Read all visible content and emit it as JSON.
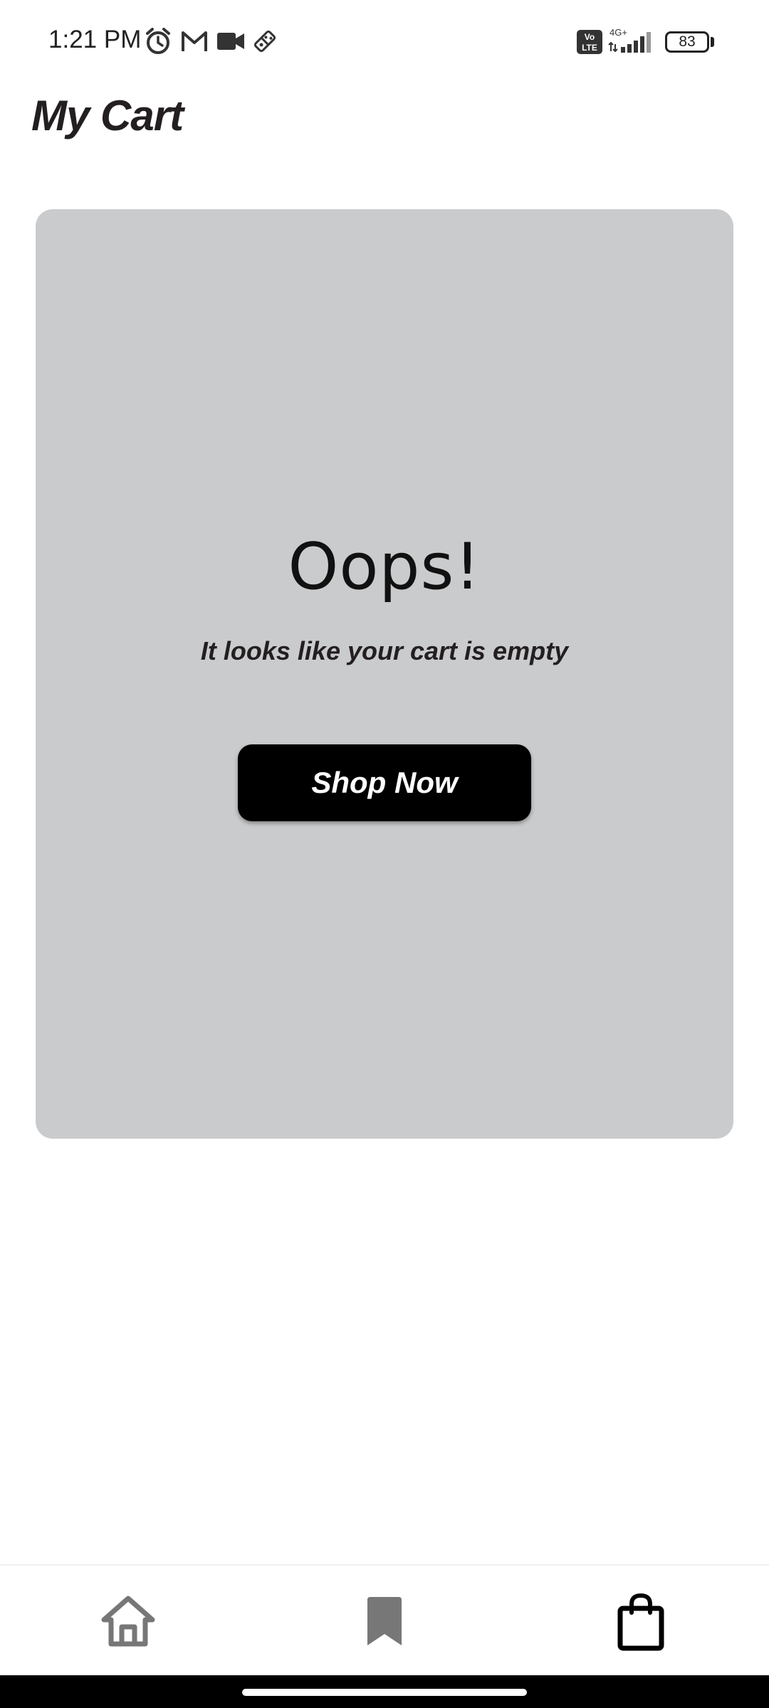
{
  "status_bar": {
    "time": "1:21 PM",
    "left_icons": [
      "alarm-icon",
      "gmail-icon",
      "video-camera-icon",
      "dominos-icon"
    ],
    "right_icons": [
      "volte-icon",
      "signal-4g-icon"
    ],
    "volte_label": "Vo LTE",
    "network_label": "4G+",
    "battery_level": "83"
  },
  "header": {
    "title": "My Cart"
  },
  "empty_state": {
    "heading": "Oops!",
    "message": "It looks like your cart is empty",
    "button_label": "Shop Now"
  },
  "bottom_nav": {
    "items": [
      {
        "icon": "home-icon",
        "active": false
      },
      {
        "icon": "bookmark-icon",
        "active": false
      },
      {
        "icon": "shopping-bag-icon",
        "active": true
      }
    ]
  },
  "colors": {
    "card_background": "#cacbcd",
    "button_background": "#000000",
    "button_text": "#ffffff",
    "title_text": "#231f20",
    "inactive_nav_icon": "#777777",
    "active_nav_icon": "#000000"
  }
}
